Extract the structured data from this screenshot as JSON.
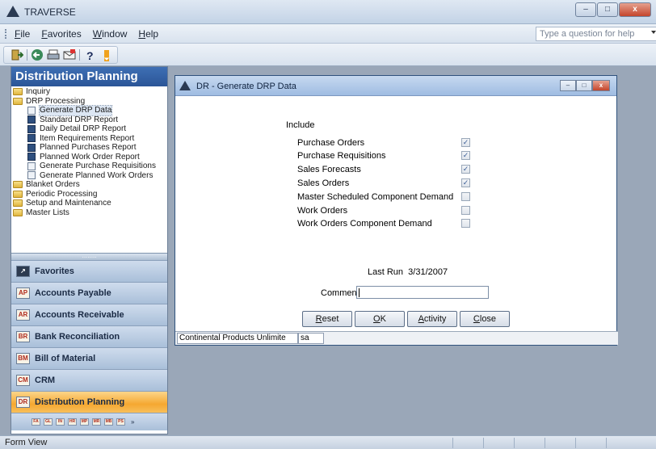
{
  "app": {
    "title": "TRAVERSE"
  },
  "window_controls": {
    "minimize": "–",
    "maximize": "□",
    "close": "x"
  },
  "menu": {
    "items": [
      "File",
      "Favorites",
      "Window",
      "Help"
    ],
    "help_placeholder": "Type a question for help"
  },
  "toolbar": {
    "icons": [
      "exit-icon",
      "back-icon",
      "print-icon",
      "envelope-icon",
      "help-icon"
    ]
  },
  "nav": {
    "title": "Distribution Planning",
    "tree": [
      {
        "label": "Inquiry",
        "icon": "folder-icon",
        "level": 0
      },
      {
        "label": "DRP Processing",
        "icon": "folder-open-icon",
        "level": 0
      },
      {
        "label": "Generate DRP Data",
        "icon": "form-icon",
        "level": 1,
        "selected": true
      },
      {
        "label": "Standard DRP Report",
        "icon": "report-icon",
        "level": 1
      },
      {
        "label": "Daily Detail DRP Report",
        "icon": "report-icon",
        "level": 1
      },
      {
        "label": "Item Requirements Report",
        "icon": "report-icon",
        "level": 1
      },
      {
        "label": "Planned Purchases Report",
        "icon": "report-icon",
        "level": 1
      },
      {
        "label": "Planned Work Order Report",
        "icon": "report-icon",
        "level": 1
      },
      {
        "label": "Generate Purchase Requisitions",
        "icon": "form-icon",
        "level": 1
      },
      {
        "label": "Generate Planned Work Orders",
        "icon": "form-icon",
        "level": 1
      },
      {
        "label": "Blanket Orders",
        "icon": "folder-icon",
        "level": 0
      },
      {
        "label": "Periodic Processing",
        "icon": "folder-icon",
        "level": 0
      },
      {
        "label": "Setup and Maintenance",
        "icon": "folder-icon",
        "level": 0
      },
      {
        "label": "Master Lists",
        "icon": "folder-icon",
        "level": 0
      }
    ],
    "splitter_grip": "........",
    "modules": [
      {
        "badge": "↗",
        "label": "Favorites",
        "active": false
      },
      {
        "badge": "AP",
        "label": "Accounts Payable",
        "active": false
      },
      {
        "badge": "AR",
        "label": "Accounts Receivable",
        "active": false
      },
      {
        "badge": "BR",
        "label": "Bank Reconciliation",
        "active": false
      },
      {
        "badge": "BM",
        "label": "Bill of Material",
        "active": false
      },
      {
        "badge": "CM",
        "label": "CRM",
        "active": false
      },
      {
        "badge": "DR",
        "label": "Distribution Planning",
        "active": true
      }
    ],
    "mini_modules": [
      "FA",
      "GL",
      "IN",
      "HR",
      "MP",
      "MR",
      "MB",
      "PS"
    ],
    "mini_more": "»"
  },
  "form": {
    "title": "DR - Generate DRP Data",
    "include_label": "Include",
    "options": [
      {
        "label": "Purchase Orders",
        "checked": true
      },
      {
        "label": "Purchase Requisitions",
        "checked": true
      },
      {
        "label": "Sales Forecasts",
        "checked": true
      },
      {
        "label": "Sales Orders",
        "checked": true
      },
      {
        "label": "Master Scheduled Component Demand",
        "checked": false
      },
      {
        "label": "Work Orders",
        "checked": false
      },
      {
        "label": "Work Orders Component Demand",
        "checked": false
      }
    ],
    "last_run_label": "Last Run",
    "last_run_date": "3/31/2007",
    "comments_label": "Comments",
    "comments_value": "",
    "buttons": {
      "reset": "Reset",
      "ok": "OK",
      "activity": "Activity",
      "close": "Close"
    },
    "status": {
      "company": "Continental Products Unlimite",
      "user": "sa"
    }
  },
  "statusbar": {
    "text": "Form View"
  },
  "colors": {
    "nav_header": "#2b5597",
    "active_module": "#f5a831",
    "workspace": "#9aa7b8"
  }
}
